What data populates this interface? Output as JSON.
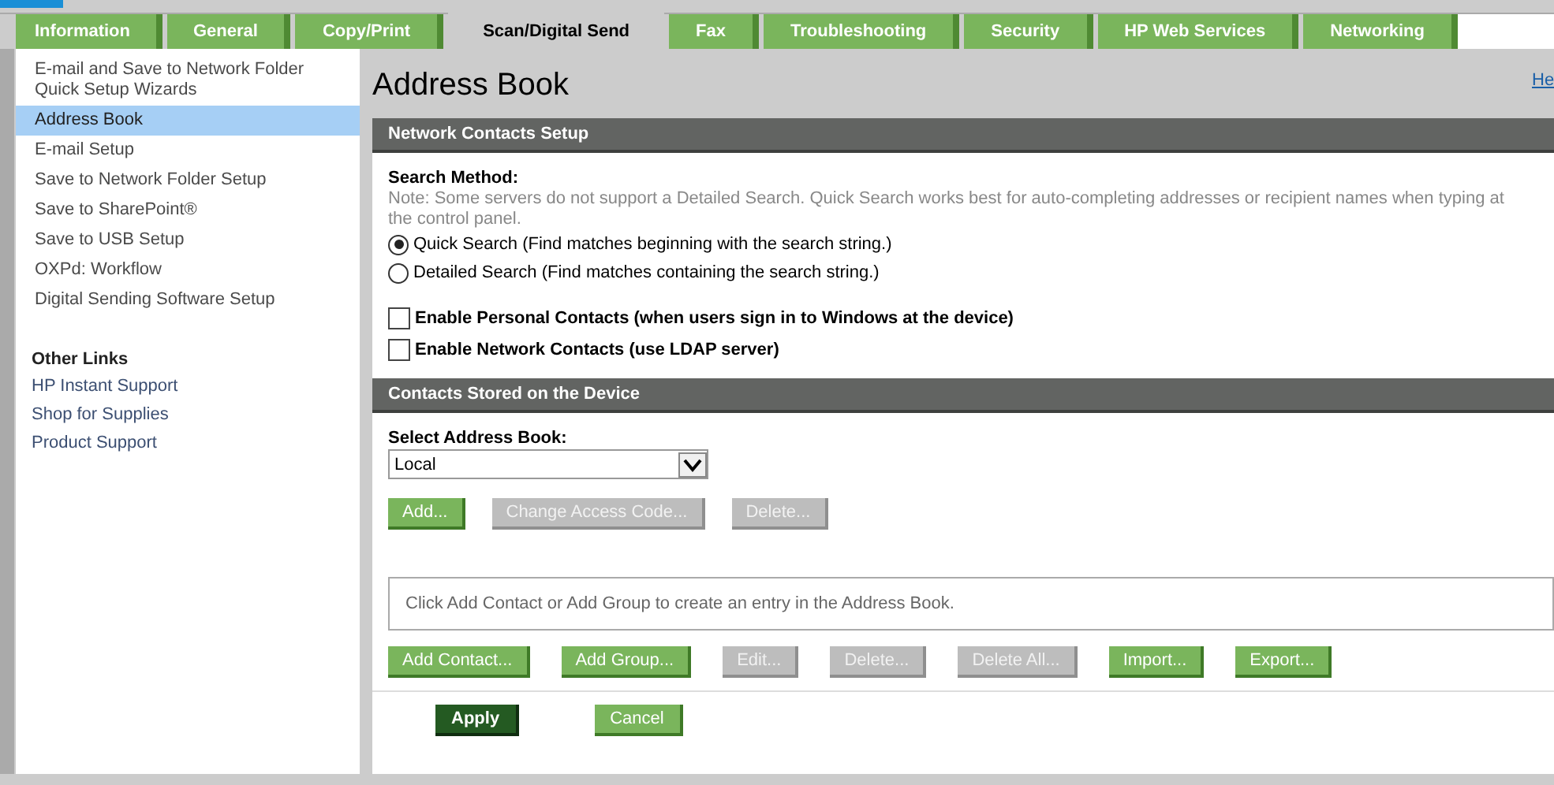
{
  "tabs": [
    {
      "label": "Information",
      "selected": false
    },
    {
      "label": "General",
      "selected": false
    },
    {
      "label": "Copy/Print",
      "selected": false
    },
    {
      "label": "Scan/Digital Send",
      "selected": true
    },
    {
      "label": "Fax",
      "selected": false
    },
    {
      "label": "Troubleshooting",
      "selected": false
    },
    {
      "label": "Security",
      "selected": false
    },
    {
      "label": "HP Web Services",
      "selected": false
    },
    {
      "label": "Networking",
      "selected": false
    }
  ],
  "sidebar": {
    "items": [
      {
        "label": "E-mail and Save to Network Folder Quick Setup Wizards",
        "selected": false
      },
      {
        "label": "Address Book",
        "selected": true
      },
      {
        "label": "E-mail Setup",
        "selected": false
      },
      {
        "label": "Save to Network Folder Setup",
        "selected": false
      },
      {
        "label": "Save to SharePoint®",
        "selected": false
      },
      {
        "label": "Save to USB Setup",
        "selected": false
      },
      {
        "label": "OXPd: Workflow",
        "selected": false
      },
      {
        "label": "Digital Sending Software Setup",
        "selected": false
      }
    ],
    "other_links_title": "Other Links",
    "other_links": [
      "HP Instant Support",
      "Shop for Supplies",
      "Product Support"
    ]
  },
  "page": {
    "title": "Address Book",
    "help_link": "He"
  },
  "network_section": {
    "header": "Network Contacts Setup",
    "search_label": "Search Method:",
    "note": "Note: Some servers do not support a Detailed Search. Quick Search works best for auto-completing addresses or recipient names when typing at the control panel.",
    "radios": [
      {
        "label": "Quick Search (Find matches beginning with the search string.)",
        "selected": true
      },
      {
        "label": "Detailed Search (Find matches containing the search string.)",
        "selected": false
      }
    ],
    "checkboxes": [
      {
        "label": "Enable Personal Contacts (when users sign in to Windows at the device)",
        "checked": false
      },
      {
        "label": "Enable Network Contacts (use LDAP server)",
        "checked": false
      }
    ]
  },
  "contacts_section": {
    "header": "Contacts Stored on the Device",
    "select_label": "Select Address Book:",
    "select_value": "Local",
    "book_buttons": [
      {
        "label": "Add...",
        "disabled": false
      },
      {
        "label": "Change Access Code...",
        "disabled": true
      },
      {
        "label": "Delete...",
        "disabled": true
      }
    ],
    "empty_message": "Click Add Contact or Add Group to create an entry in the Address Book.",
    "contact_buttons": [
      {
        "label": "Add Contact...",
        "disabled": false
      },
      {
        "label": "Add Group...",
        "disabled": false
      },
      {
        "label": "Edit...",
        "disabled": true
      },
      {
        "label": "Delete...",
        "disabled": true
      },
      {
        "label": "Delete All...",
        "disabled": true
      },
      {
        "label": "Import...",
        "disabled": false
      },
      {
        "label": "Export...",
        "disabled": false
      }
    ]
  },
  "footer_buttons": [
    {
      "label": "Apply",
      "kind": "primary"
    },
    {
      "label": "Cancel",
      "kind": "secondary"
    }
  ]
}
